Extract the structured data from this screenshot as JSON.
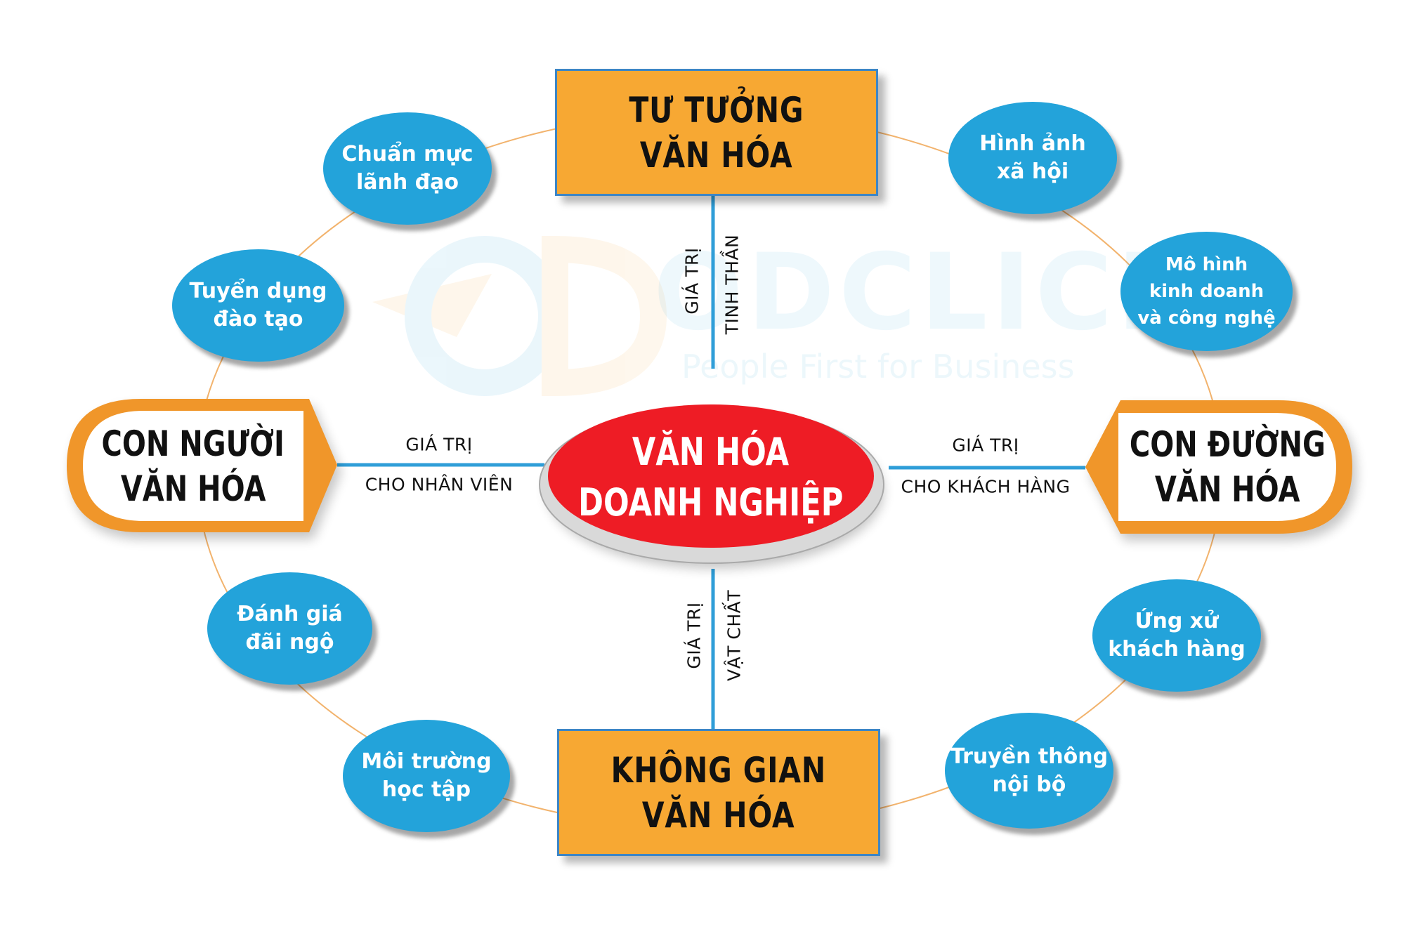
{
  "watermark": {
    "brand": "ODCLICK",
    "tagline": "People First for Business"
  },
  "center": {
    "line1": "VĂN HÓA",
    "line2": "DOANH NGHIỆP"
  },
  "top_box": {
    "line1": "TƯ TƯỞNG",
    "line2": "VĂN HÓA"
  },
  "bottom_box": {
    "line1": "KHÔNG GIAN",
    "line2": "VĂN HÓA"
  },
  "left_tag": {
    "line1": "CON NGƯỜI",
    "line2": "VĂN HÓA"
  },
  "right_tag": {
    "line1": "CON ĐƯỜNG",
    "line2": "VĂN HÓA"
  },
  "connectors": {
    "top": {
      "line1": "GIÁ TRỊ",
      "line2": "TINH THẦN"
    },
    "bottom": {
      "line1": "GIÁ TRỊ",
      "line2": "VẬT CHẤT"
    },
    "left": {
      "line1": "GIÁ TRỊ",
      "line2": "CHO NHÂN VIÊN"
    },
    "right": {
      "line1": "GIÁ TRỊ",
      "line2": "CHO KHÁCH HÀNG"
    }
  },
  "bubbles": {
    "leadership": {
      "line1": "Chuẩn mực",
      "line2": "lãnh đạo"
    },
    "recruit": {
      "line1": "Tuyển dụng",
      "line2": "đào tạo"
    },
    "evaluate": {
      "line1": "Đánh giá",
      "line2": "đãi ngộ"
    },
    "learning": {
      "line1": "Môi trường",
      "line2": "học tập"
    },
    "social": {
      "line1": "Hình ảnh",
      "line2": "xã hội"
    },
    "model": {
      "line1": "Mô hình",
      "line2": "kinh doanh",
      "line3": "và công nghệ"
    },
    "customer": {
      "line1": "Ứng xử",
      "line2": "khách hàng"
    },
    "internal": {
      "line1": "Truyền thông",
      "line2": "nội bộ"
    }
  },
  "colors": {
    "orange": "#f7a833",
    "blue": "#23a3da",
    "red": "#ee1c25",
    "connector": "#2f9ed8",
    "ring": "#f2b36d"
  }
}
